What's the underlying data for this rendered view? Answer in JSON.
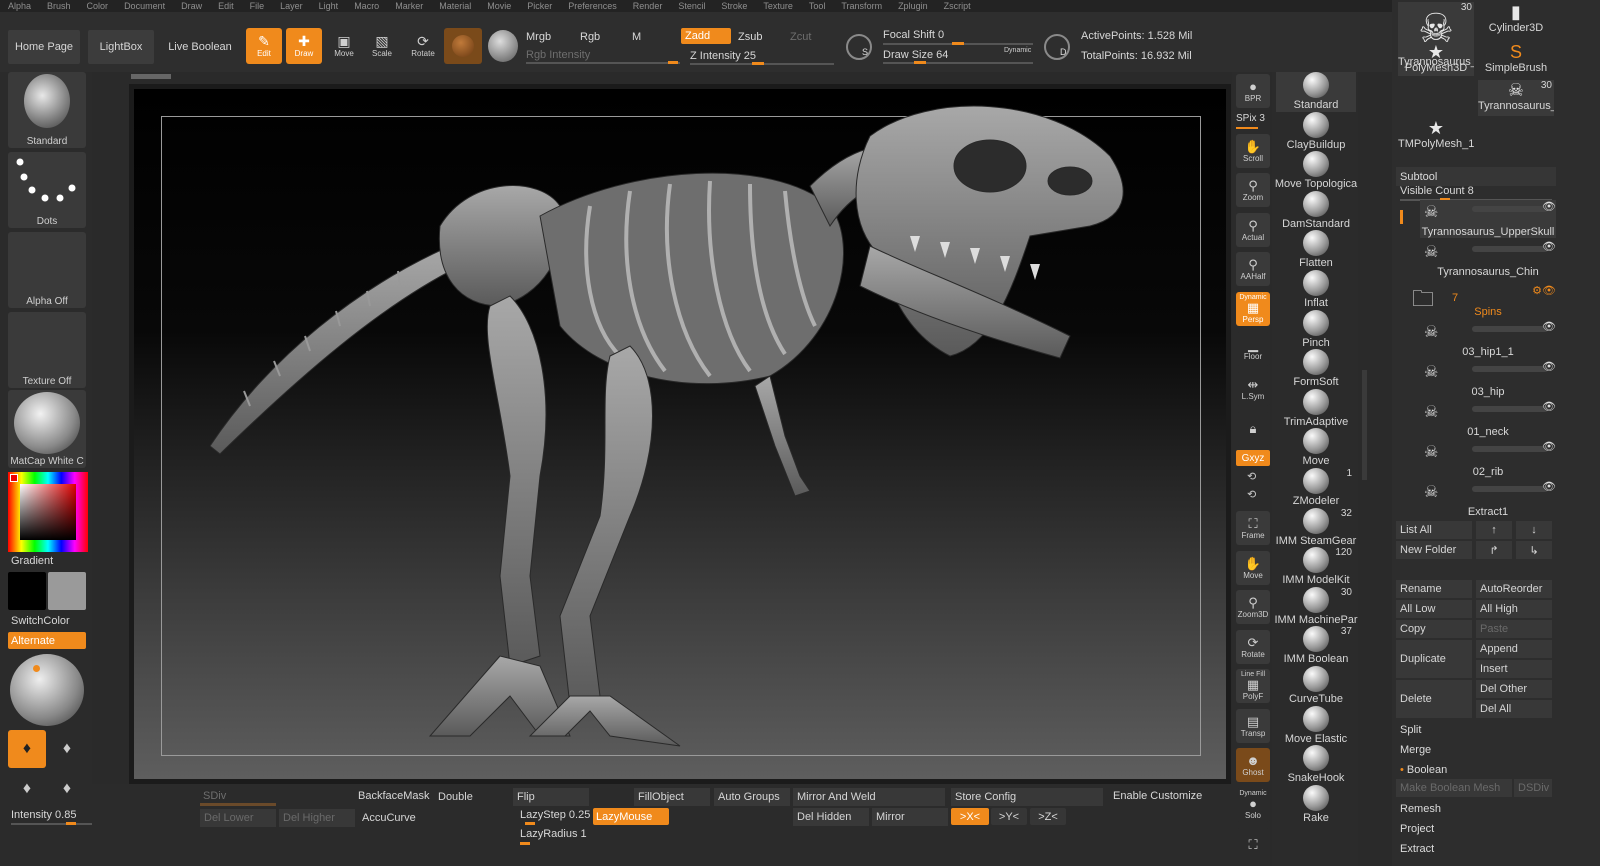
{
  "menu": [
    "Alpha",
    "Brush",
    "Color",
    "Document",
    "Draw",
    "Edit",
    "File",
    "Layer",
    "Light",
    "Macro",
    "Marker",
    "Material",
    "Movie",
    "Picker",
    "Preferences",
    "Render",
    "Stencil",
    "Stroke",
    "Texture",
    "Tool",
    "Transform",
    "Zplugin",
    "Zscript"
  ],
  "topbar": {
    "home_page": "Home Page",
    "lightbox": "LightBox",
    "live_boolean": "Live Boolean",
    "edit": "Edit",
    "draw": "Draw",
    "move": "Move",
    "scale": "Scale",
    "rotate": "Rotate",
    "mrgb": "Mrgb",
    "rgb": "Rgb",
    "m": "M",
    "zadd": "Zadd",
    "zsub": "Zsub",
    "zcut": "Zcut",
    "rgb_intensity": "Rgb Intensity",
    "z_intensity": "Z Intensity 25",
    "focal_shift": "Focal Shift 0",
    "draw_size": "Draw Size 64",
    "dynamic": "Dynamic",
    "active_points": "ActivePoints: 1.528 Mil",
    "total_points": "TotalPoints: 16.932 Mil",
    "s_label": "S",
    "d_label": "D"
  },
  "left": {
    "standard": "Standard",
    "dots": "Dots",
    "alpha_off": "Alpha Off",
    "texture_off": "Texture Off",
    "matcap": "MatCap White C",
    "gradient": "Gradient",
    "switch_color": "SwitchColor",
    "alternate": "Alternate",
    "intensity": "Intensity 0.85"
  },
  "rtools": {
    "bpr": "BPR",
    "spix": "SPix 3",
    "scroll": "Scroll",
    "zoom": "Zoom",
    "actual": "Actual",
    "aahalf": "AAHalf",
    "dynamic": "Dynamic",
    "persp": "Persp",
    "floor": "Floor",
    "lsym": "L.Sym",
    "xyz": "Gxyz",
    "frame": "Frame",
    "move": "Move",
    "zoom3d": "Zoom3D",
    "rotate": "Rotate",
    "line_fill": "Line Fill",
    "polyf": "PolyF",
    "transp": "Transp",
    "ghost": "Ghost",
    "solo": "Solo"
  },
  "brushes": [
    {
      "name": "Standard",
      "count": ""
    },
    {
      "name": "ClayBuildup",
      "count": ""
    },
    {
      "name": "Move Topologica",
      "count": ""
    },
    {
      "name": "DamStandard",
      "count": ""
    },
    {
      "name": "Flatten",
      "count": ""
    },
    {
      "name": "Inflat",
      "count": ""
    },
    {
      "name": "Pinch",
      "count": ""
    },
    {
      "name": "FormSoft",
      "count": ""
    },
    {
      "name": "TrimAdaptive",
      "count": ""
    },
    {
      "name": "Move",
      "count": ""
    },
    {
      "name": "ZModeler",
      "count": "1"
    },
    {
      "name": "IMM SteamGear",
      "count": "32"
    },
    {
      "name": "IMM ModelKit",
      "count": "120"
    },
    {
      "name": "IMM MachinePar",
      "count": "30"
    },
    {
      "name": "IMM Boolean",
      "count": "37"
    },
    {
      "name": "CurveTube",
      "count": ""
    },
    {
      "name": "Move Elastic",
      "count": ""
    },
    {
      "name": "SnakeHook",
      "count": ""
    },
    {
      "name": "Rake",
      "count": ""
    }
  ],
  "tool_thumbs": [
    {
      "name": "Tyrannosaurus_l",
      "count": "30"
    },
    {
      "name": "Cylinder3D",
      "count": ""
    },
    {
      "name": "PolyMesh3D",
      "count": ""
    },
    {
      "name": "SimpleBrush",
      "count": ""
    },
    {
      "name": "Tyrannosaurus_l",
      "count": "30"
    },
    {
      "name": "TMPolyMesh_1",
      "count": ""
    }
  ],
  "subtool": {
    "title": "Subtool",
    "visible_count": "Visible Count 8",
    "items": [
      {
        "name": "Tyrannosaurus_UpperSkull"
      },
      {
        "name": "Tyrannosaurus_Chin"
      },
      {
        "name": "Spins",
        "folder_count": "7"
      },
      {
        "name": "03_hip1_1"
      },
      {
        "name": "03_hip"
      },
      {
        "name": "01_neck"
      },
      {
        "name": "02_rib"
      },
      {
        "name": "Extract1"
      }
    ],
    "list_all": "List All",
    "new_folder": "New Folder",
    "rename": "Rename",
    "auto_reorder": "AutoReorder",
    "all_low": "All Low",
    "all_high": "All High",
    "copy": "Copy",
    "paste": "Paste",
    "duplicate": "Duplicate",
    "append": "Append",
    "insert": "Insert",
    "delete": "Delete",
    "del_other": "Del Other",
    "del_all": "Del All",
    "split": "Split",
    "merge": "Merge",
    "boolean": "Boolean",
    "make_boolean_mesh": "Make Boolean Mesh",
    "dsdiv": "DSDiv",
    "remesh": "Remesh",
    "project": "Project",
    "extract": "Extract"
  },
  "bottom": {
    "sdiv": "SDiv",
    "del_lower": "Del Lower",
    "del_higher": "Del Higher",
    "backface_mask": "BackfaceMask",
    "double": "Double",
    "accucurve": "AccuCurve",
    "flip": "Flip",
    "lazystep": "LazyStep 0.25",
    "lazyradius": "LazyRadius 1",
    "lazymouse": "LazyMouse",
    "fill_object": "FillObject",
    "auto_groups": "Auto Groups",
    "mirror_weld": "Mirror And Weld",
    "del_hidden": "Del Hidden",
    "mirror": "Mirror",
    "store_config": "Store Config",
    "x": ">X<",
    "y": ">Y<",
    "z": ">Z<",
    "enable_customize": "Enable Customize"
  },
  "colors": {
    "accent": "#f08a1c",
    "panel": "#2b2b2b",
    "button": "#3c3c3c"
  }
}
